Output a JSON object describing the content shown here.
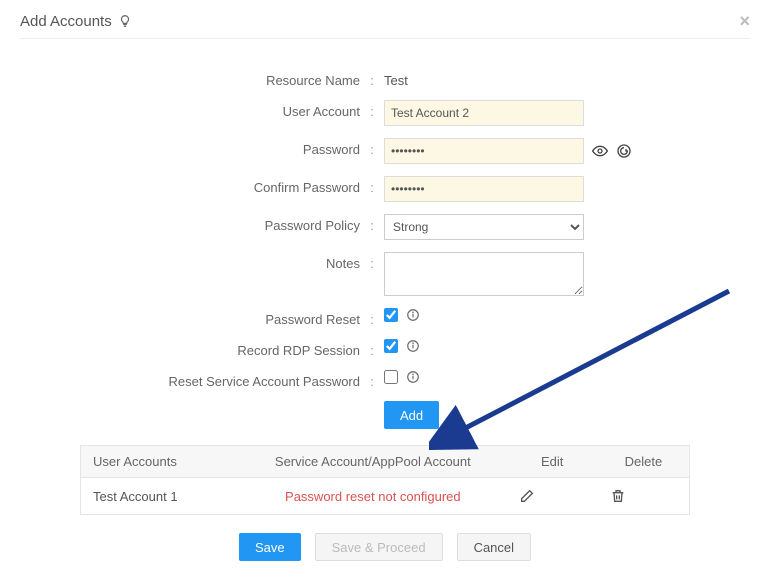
{
  "header": {
    "title": "Add Accounts"
  },
  "form": {
    "resource_name_label": "Resource Name",
    "resource_name_value": "Test",
    "user_account_label": "User Account",
    "user_account_value": "Test Account 2",
    "password_label": "Password",
    "password_value": "••••••••",
    "confirm_password_label": "Confirm Password",
    "confirm_password_value": "••••••••",
    "password_policy_label": "Password Policy",
    "password_policy_value": "Strong",
    "notes_label": "Notes",
    "notes_value": "",
    "password_reset_label": "Password Reset",
    "record_rdp_label": "Record RDP Session",
    "reset_svc_pwd_label": "Reset Service Account Password",
    "add_button": "Add"
  },
  "table": {
    "col_user_accounts": "User Accounts",
    "col_service": "Service Account/AppPool Account",
    "col_edit": "Edit",
    "col_delete": "Delete",
    "rows": [
      {
        "account": "Test Account 1",
        "service": "Password reset not configured"
      }
    ]
  },
  "actions": {
    "save": "Save",
    "save_proceed": "Save & Proceed",
    "cancel": "Cancel"
  }
}
